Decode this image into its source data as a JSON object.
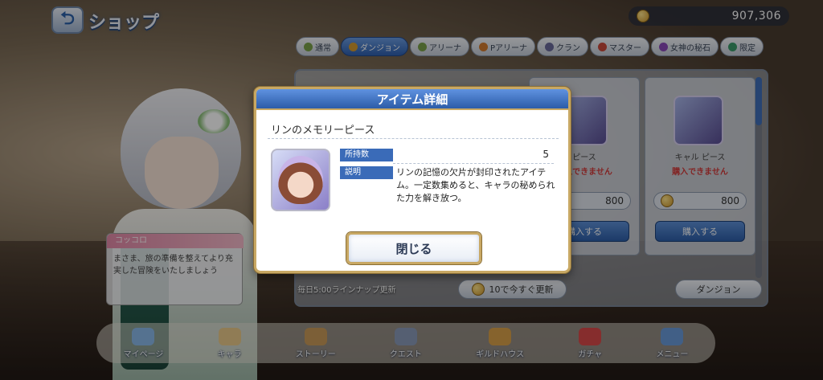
{
  "header": {
    "title": "ショップ",
    "coins": "907,306"
  },
  "tabs": [
    {
      "label": "通常",
      "color": "#7aa04a"
    },
    {
      "label": "ダンジョン",
      "color": "#d49a2e",
      "active": true
    },
    {
      "label": "アリーナ",
      "color": "#7aa04a"
    },
    {
      "label": "Pアリーナ",
      "color": "#d07a2e"
    },
    {
      "label": "クラン",
      "color": "#6a6a9a"
    },
    {
      "label": "マスター",
      "color": "#c84a3a"
    },
    {
      "label": "女神の秘石",
      "color": "#8a4ab8"
    },
    {
      "label": "限定",
      "color": "#3a9a6a"
    }
  ],
  "shop_cards": [
    {
      "name": "ピース",
      "warning": "購入できません",
      "price": "800",
      "buy_label": "購入する"
    },
    {
      "name": "キャル ピース",
      "warning": "購入できません",
      "price": "800",
      "buy_label": "購入する"
    }
  ],
  "shop_footer": {
    "lineup_text": "毎日5:00ラインナップ更新",
    "refresh_label": "10で今すぐ更新",
    "dungeon_label": "ダンジョン"
  },
  "speech": {
    "speaker": "コッコロ",
    "text": "まさま、旅の準備を整えてより充実した冒険をいたしましょう"
  },
  "bottom_nav": [
    {
      "label": "マイページ",
      "color": "#8ab8e8"
    },
    {
      "label": "キャラ",
      "color": "#e8c88a"
    },
    {
      "label": "ストーリー",
      "color": "#c89a5a"
    },
    {
      "label": "クエスト",
      "color": "#8a9ab8"
    },
    {
      "label": "ギルドハウス",
      "color": "#d8a04a"
    },
    {
      "label": "ガチャ",
      "color": "#d84a4a"
    },
    {
      "label": "メニュー",
      "color": "#6a9ad8"
    }
  ],
  "modal": {
    "title": "アイテム詳細",
    "item_name": "リンのメモリーピース",
    "owned_label": "所持数",
    "owned_value": "5",
    "description_label": "説明",
    "description": "リンの記憶の欠片が封印されたアイテム。一定数集めると、キャラの秘められた力を解き放つ。",
    "close_label": "閉じる"
  }
}
